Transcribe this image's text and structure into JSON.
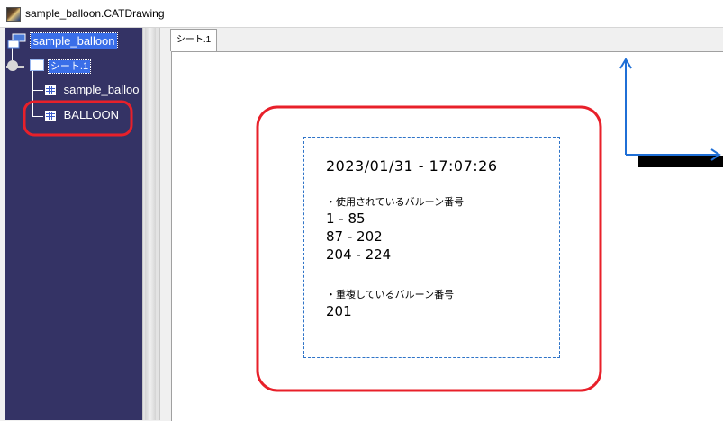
{
  "window": {
    "title": "sample_balloon.CATDrawing",
    "icon": "catia-drawing-icon"
  },
  "tree": {
    "root": {
      "label": "sample_balloon",
      "icon": "drawing-root-icon"
    },
    "sheet": {
      "label": "シート.1",
      "icon": "sheet-icon"
    },
    "children": [
      {
        "label": "sample_balloo",
        "icon": "view-icon"
      },
      {
        "label": "BALLOON",
        "icon": "view-icon"
      }
    ]
  },
  "tabs": [
    {
      "label": "シート.1"
    }
  ],
  "balloon_report": {
    "timestamp": "2023/01/31 - 17:07:26",
    "used_heading": "・使用されているバルーン番号",
    "used_ranges": [
      "1 - 85",
      "87 - 202",
      "204 - 224"
    ],
    "duplicate_heading": "・重複しているバルーン番号",
    "duplicates": [
      "201"
    ]
  },
  "colors": {
    "tree_bg": "#343365",
    "highlight": "#e8202a",
    "axis": "#1f6fd6",
    "selection": "#3a6ee8",
    "frame_dash": "#2f74c8"
  }
}
